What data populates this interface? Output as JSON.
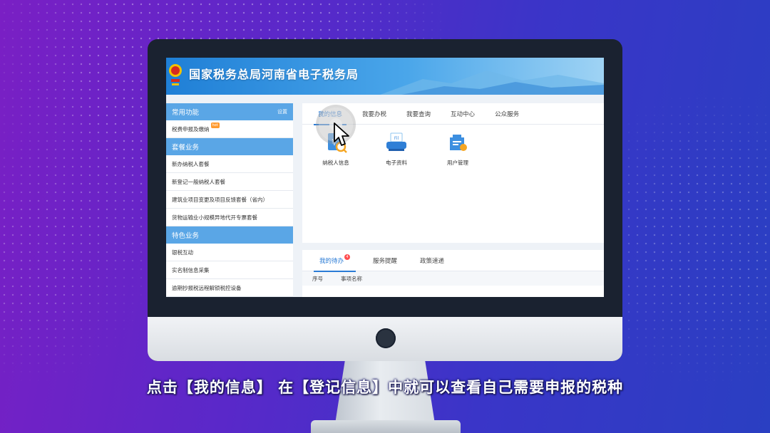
{
  "header": {
    "title": "国家税务总局河南省电子税务局"
  },
  "sidebar": {
    "groups": [
      {
        "title": "常用功能",
        "action": "设置",
        "items": [
          {
            "label": "税费申报及缴纳",
            "badge": "hot"
          }
        ]
      },
      {
        "title": "套餐业务",
        "items": [
          {
            "label": "新办纳税人套餐"
          },
          {
            "label": "新登记一般纳税人套餐"
          },
          {
            "label": "建筑业项目变更及项目反馈套餐（省内）"
          },
          {
            "label": "货物运输业小规模异地代开专票套餐"
          }
        ]
      },
      {
        "title": "特色业务",
        "items": [
          {
            "label": "银税互动"
          },
          {
            "label": "实名制信息采集"
          },
          {
            "label": "逾期抄报税远程解锁税控设备"
          }
        ]
      }
    ]
  },
  "main_tabs": [
    {
      "label": "我的信息",
      "active": true
    },
    {
      "label": "我要办税"
    },
    {
      "label": "我要查询"
    },
    {
      "label": "互动中心"
    },
    {
      "label": "公众服务"
    }
  ],
  "quick_icons": [
    {
      "label": "纳税人信息",
      "icon": "taxpayer-info-icon",
      "glyph": "¥"
    },
    {
      "label": "电子资料",
      "icon": "electronic-docs-icon",
      "glyph": "Fil"
    },
    {
      "label": "用户管理",
      "icon": "user-management-icon"
    }
  ],
  "todo": {
    "tabs": [
      {
        "label": "我的待办",
        "active": true,
        "badge": "4"
      },
      {
        "label": "服务提醒"
      },
      {
        "label": "政策速递"
      }
    ],
    "columns": [
      "序号",
      "事项名称"
    ]
  },
  "subtitle": "点击【我的信息】 在【登记信息】中就可以查看自己需要申报的税种",
  "colors": {
    "accent": "#2a7bd6",
    "sidebar_header": "#5aa6e6",
    "hot_badge": "#ff9a2e",
    "todo_badge": "#ff4d4f"
  }
}
